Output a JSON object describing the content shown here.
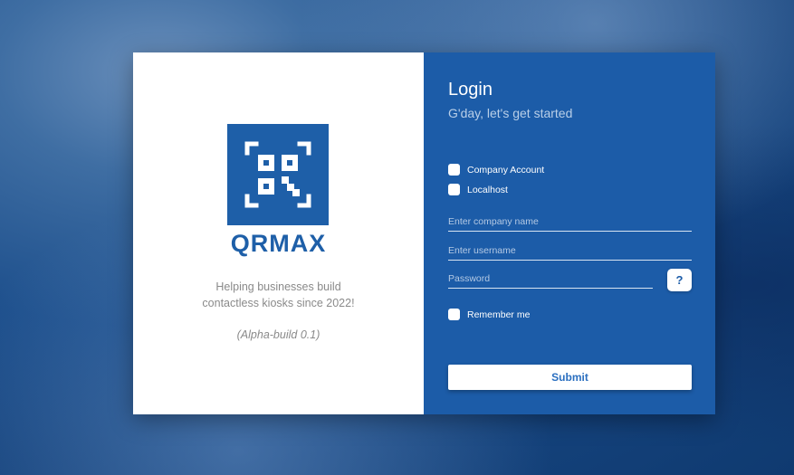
{
  "brand": {
    "name": "QRMAX",
    "tagline_line1": "Helping businesses build",
    "tagline_line2": "contactless kiosks since 2022!",
    "build": "(Alpha-build 0.1)",
    "logo_icon": "qr-code-icon",
    "color": "#1e5fa8"
  },
  "login": {
    "title": "Login",
    "subtitle": "G'day, let's get started",
    "company_account_label": "Company Account",
    "company_account_checked": false,
    "localhost_label": "Localhost",
    "localhost_checked": false,
    "company_placeholder": "Enter company name",
    "username_placeholder": "Enter username",
    "password_placeholder": "Password",
    "help_label": "?",
    "remember_label": "Remember me",
    "remember_checked": false,
    "submit_label": "Submit",
    "panel_color": "#1c5ca8"
  }
}
